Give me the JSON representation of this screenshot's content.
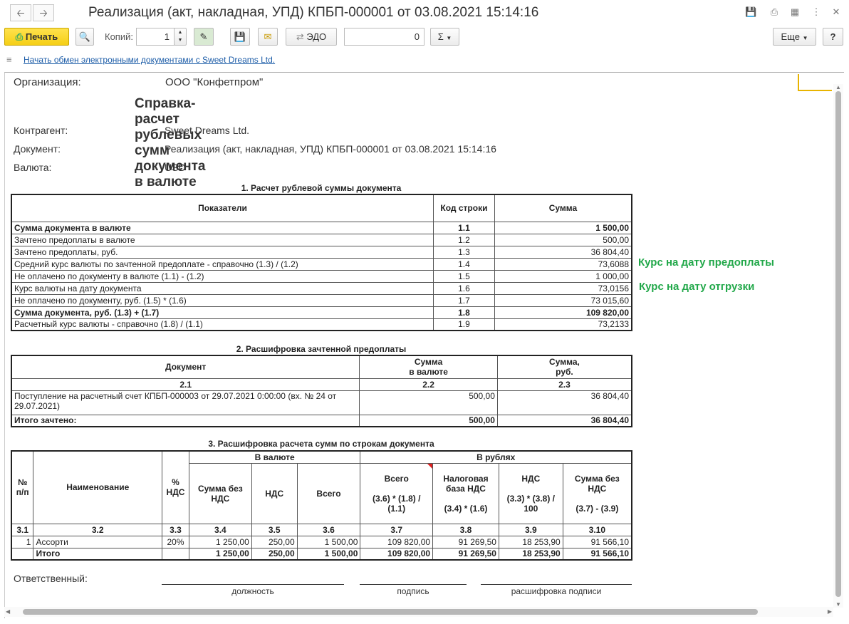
{
  "window": {
    "title": "Реализация (акт, накладная, УПД) КПБП-000001 от 03.08.2021 15:14:16",
    "back_icon": "arrow-left-icon",
    "forward_icon": "arrow-right-icon"
  },
  "toolbar": {
    "print_label": "Печать",
    "copies_label": "Копий:",
    "copies_value": "1",
    "edo_label": "ЭДО",
    "sum_value": "0",
    "sigma_label": "Σ",
    "more_label": "Еще",
    "help_label": "?"
  },
  "edo_link": "Начать обмен электронными документами с Sweet Dreams Ltd.",
  "doc": {
    "org_label": "Организация:",
    "org_value": "ООО \"Конфетпром\"",
    "heading": "Справка-расчет рублевых сумм документа в валюте",
    "counterparty_label": "Контрагент:",
    "counterparty_value": "Sweet Dreams Ltd.",
    "document_label": "Документ:",
    "document_value": "Реализация (акт, накладная, УПД) КПБП-000001 от 03.08.2021 15:14:16",
    "currency_label": "Валюта:",
    "currency_value": "USD"
  },
  "section1": {
    "title": "1. Расчет рублевой суммы документа",
    "headers": [
      "Показатели",
      "Код строки",
      "Сумма"
    ],
    "rows": [
      {
        "name": "Сумма документа в валюте",
        "code": "1.1",
        "sum": "1 500,00",
        "bold": true
      },
      {
        "name": "Зачтено предоплаты в валюте",
        "code": "1.2",
        "sum": "500,00",
        "bold": false
      },
      {
        "name": "Зачтено предоплаты, руб.",
        "code": "1.3",
        "sum": "36 804,40",
        "bold": false
      },
      {
        "name": "Средний курс валюты по зачтенной предоплате - справочно  (1.3) / (1.2)",
        "code": "1.4",
        "sum": "73,6088",
        "bold": false
      },
      {
        "name": "Не оплачено по документу в валюте  (1.1) - (1.2)",
        "code": "1.5",
        "sum": "1 000,00",
        "bold": false
      },
      {
        "name": "Курс валюты на дату документа",
        "code": "1.6",
        "sum": "73,0156",
        "bold": false
      },
      {
        "name": "Не оплачено по документу, руб. (1.5) * (1.6)",
        "code": "1.7",
        "sum": "73 015,60",
        "bold": false
      },
      {
        "name": "Сумма документа, руб. (1.3) + (1.7)",
        "code": "1.8",
        "sum": "109 820,00",
        "bold": true
      },
      {
        "name": "Расчетный курс валюты - справочно (1.8) / (1.1)",
        "code": "1.9",
        "sum": "73,2133",
        "bold": false
      }
    ]
  },
  "notes": {
    "prepayment_rate": "Курс на дату предоплаты",
    "shipment_rate": "Курс на дату отгрузки"
  },
  "section2": {
    "title": "2. Расшифровка зачтенной предоплаты",
    "headers": [
      "Документ",
      "Сумма\nв валюте",
      "Сумма,\nруб."
    ],
    "codes": [
      "2.1",
      "2.2",
      "2.3"
    ],
    "row": {
      "doc": "Поступление на расчетный счет КПБП-000003 от 29.07.2021 0:00:00 (вх. № 24 от 29.07.2021)",
      "cur": "500,00",
      "rub": "36 804,40"
    },
    "total": {
      "label": "Итого зачтено:",
      "cur": "500,00",
      "rub": "36 804,40"
    }
  },
  "section3": {
    "title": "3. Расшифровка расчета сумм по строкам документа",
    "group_currency": "В валюте",
    "group_rub": "В рублях",
    "h_num": "№\nп/п",
    "h_name": "Наименование",
    "h_vat_pct": "%\nНДС",
    "h_sum_no_vat": "Сумма без\nНДС",
    "h_vat": "НДС",
    "h_total": "Всего",
    "h_rub_total": "Всего\n\n(3.6) * (1.8) /\n(1.1)",
    "h_tax_base": "Налоговая\nбаза НДС\n\n(3.4) * (1.6)",
    "h_rub_vat": "НДС\n\n(3.3) * (3.8) /\n100",
    "h_rub_no_vat": "Сумма без\nНДС\n\n(3.7) - (3.9)",
    "codes": [
      "3.1",
      "3.2",
      "3.3",
      "3.4",
      "3.5",
      "3.6",
      "3.7",
      "3.8",
      "3.9",
      "3.10"
    ],
    "row": [
      "1",
      "Ассорти",
      "20%",
      "1 250,00",
      "250,00",
      "1 500,00",
      "109 820,00",
      "91 269,50",
      "18 253,90",
      "91 566,10"
    ],
    "total": [
      "",
      "Итого",
      "",
      "1 250,00",
      "250,00",
      "1 500,00",
      "109 820,00",
      "91 269,50",
      "18 253,90",
      "91 566,10"
    ]
  },
  "signature": {
    "responsible_label": "Ответственный:",
    "position_caption": "должность",
    "signature_caption": "подпись",
    "decryption_caption": "расшифровка подписи"
  },
  "colors": {
    "print_button": "#f5cf16",
    "note_green": "#22a84a",
    "link_blue": "#1d5da8"
  }
}
